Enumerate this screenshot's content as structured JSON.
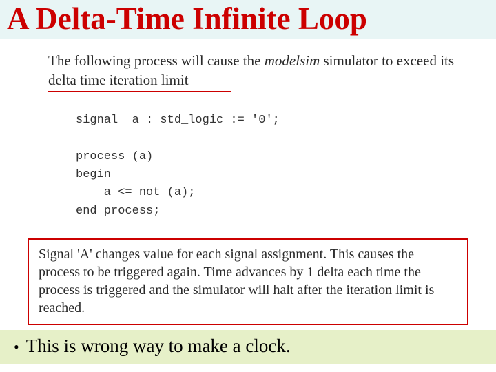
{
  "title": "A Delta-Time Infinite Loop",
  "intro": {
    "pre_italic": "The following process will cause the ",
    "italic": "modelsim",
    "post_italic": " simulator to exceed its delta time iteration limit"
  },
  "code": "signal  a : std_logic := '0';\n\nprocess (a)\nbegin\n    a <= not (a);\nend process;",
  "explain": "Signal 'A' changes value for each signal assignment. This causes the process to be triggered again.  Time advances by 1 delta each time the process is triggered and the simulator will halt after the iteration limit is reached.",
  "bullet": "This is wrong way to make a clock."
}
